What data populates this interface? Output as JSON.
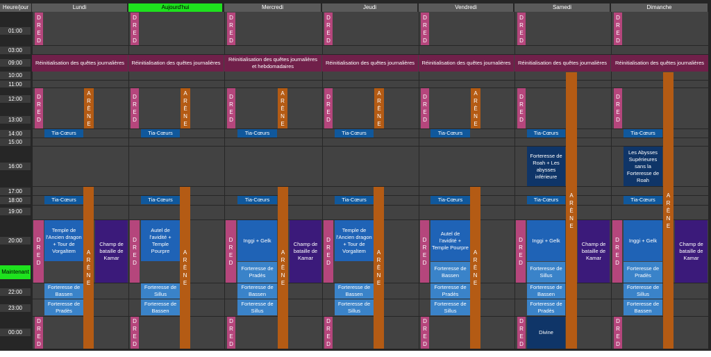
{
  "header": {
    "corner": "Heure/jour",
    "days": [
      "Lundi",
      "Aujourd'hui",
      "Mercredi",
      "Jeudi",
      "Vendredi",
      "Samedi",
      "Dimanche"
    ]
  },
  "hours": [
    "01:00",
    "03:00",
    "09:00",
    "10:00",
    "11:00",
    "12:00",
    "13:00",
    "14:00",
    "15:00",
    "16:00",
    "17:00",
    "18:00",
    "19:00",
    "20:00",
    "Maintenant",
    "22:00",
    "23:00",
    "00:00"
  ],
  "labels": {
    "dred": "D\nR\nE\nD",
    "arene": "A\nR\nÈ\nN\nE",
    "reset": "Réinitialisation des quêtes journalières",
    "reset_weekly": "Réinitialisation des quêtes journalières et hebdomadaires",
    "tia": "Tia-Cœurs",
    "kamar": "Champ de bataille de Kamar",
    "inggi": "Inggi + Gelk",
    "divine": "Divine"
  },
  "days": {
    "lundi": {
      "evening_main": "Temple de l'Ancien dragon + Tour de Vorgaltem",
      "late1": "Forteresse de Bassen",
      "late2": "Forteresse de Pradès"
    },
    "today": {
      "evening_main": "Autel de l'avidité + Temple Pourpre",
      "late1": "Forteresse de Sillus",
      "late2": "Forteresse de Bassen"
    },
    "mercredi": {
      "evening_sub": "Forteresse de Pradès",
      "late1": "Forteresse de Bassen",
      "late2": "Forteresse de Sillus"
    },
    "jeudi": {
      "evening_main": "Temple de l'Ancien dragon + Tour de Vorgaltem",
      "late1": "Forteresse de Bassen",
      "late2": "Forteresse de Sillus"
    },
    "vendredi": {
      "evening_main": "Autel de l'avidité + Temple Pourpre",
      "evening_sub": "Forteresse de Bassen",
      "late1": "Forteresse de Pradès",
      "late2": "Forteresse de Sillus"
    },
    "samedi": {
      "afternoon": "Forteresse de Roah + Les abysses inférieure",
      "evening_sub": "Forteresse de Sillus",
      "late1": "Forteresse de Bassen",
      "late2": "Forteresse de Pradès"
    },
    "dimanche": {
      "afternoon": "Les Abysses Supérieures sans la Forteresse de Roah",
      "evening_sub": "Forteresse de Pradès",
      "late1": "Forteresse de Sillus",
      "late2": "Forteresse de Bassen"
    }
  },
  "colors": {
    "today_header": "#1ee21e",
    "dred": "#b5467c",
    "arene": "#b45b14",
    "reset": "#70204a",
    "tia": "#10589c",
    "kamar": "#3b1a7a"
  }
}
